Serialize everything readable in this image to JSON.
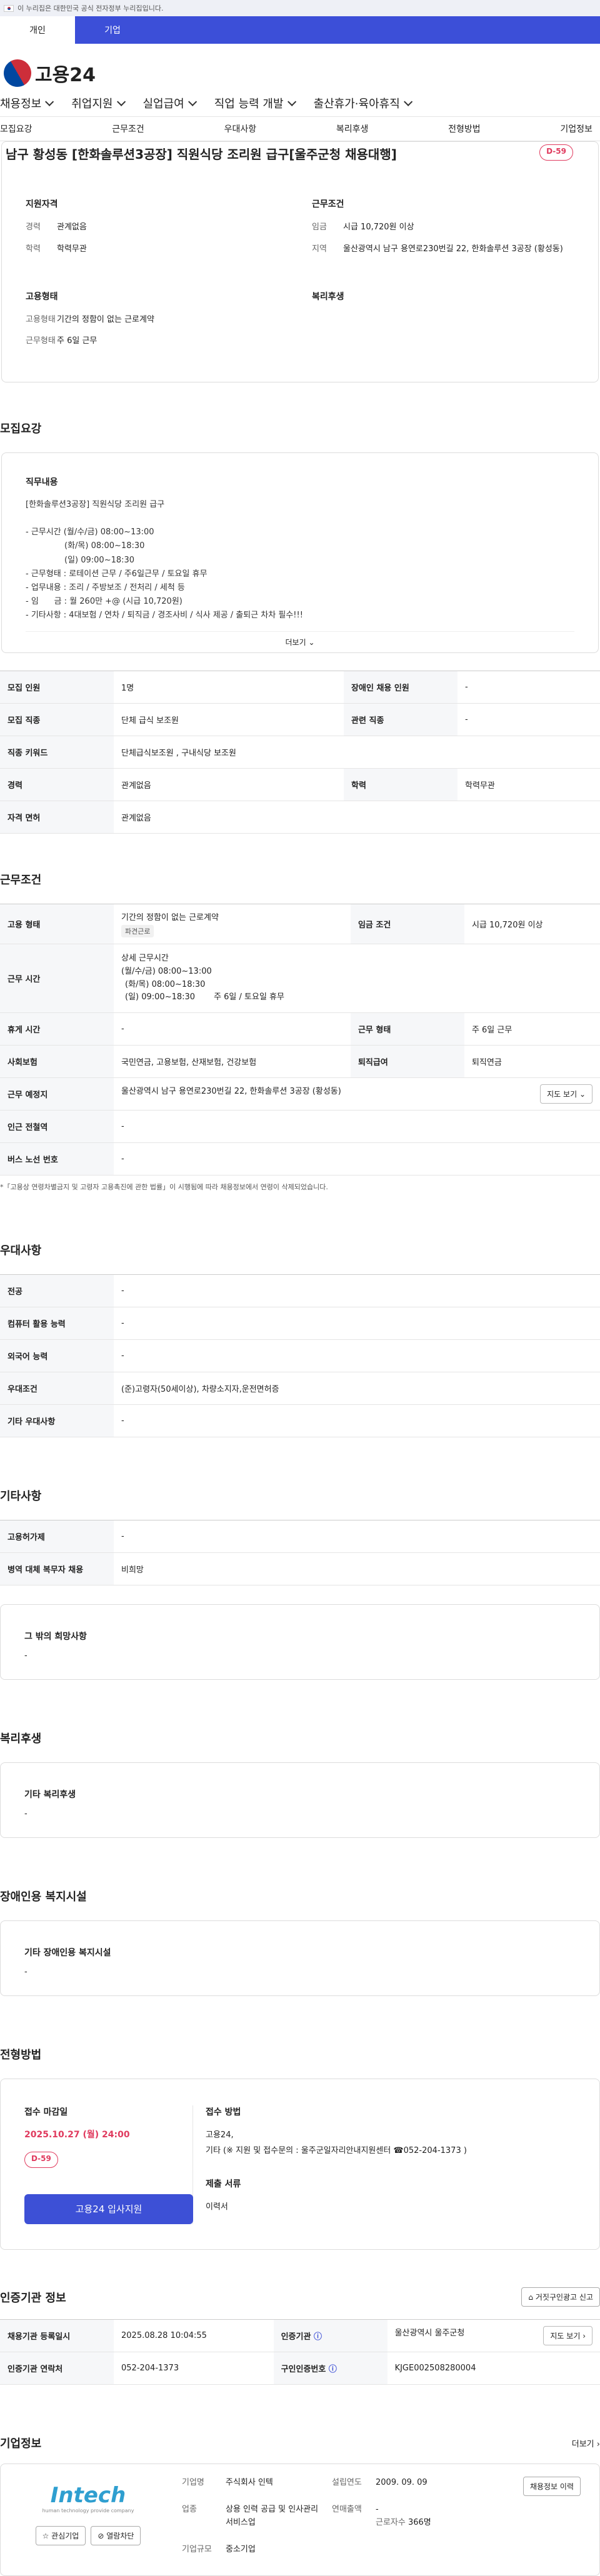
{
  "gov_notice": "이 누리집은 대한민국 공식 전자정부 누리집입니다.",
  "user_tabs": [
    "개인",
    "기업"
  ],
  "logo_text": "고용24",
  "gnb": [
    "채용정보",
    "취업지원",
    "실업급여",
    "직업 능력 개발",
    "출산휴가·육아휴직"
  ],
  "snb": [
    "모집요강",
    "근무조건",
    "우대사항",
    "복리후생",
    "전형방법",
    "기업정보"
  ],
  "title": "남구 황성동 [한화솔루션3공장] 직원식당 조리원 급구[울주군청 채용대행]",
  "dday": "D-59",
  "summary": {
    "req_title": "지원자격",
    "career_k": "경력",
    "career_v": "관계없음",
    "edu_k": "학력",
    "edu_v": "학력무관",
    "cond_title": "근무조건",
    "pay_k": "임금",
    "pay_v": "시급 10,720원 이상",
    "area_k": "지역",
    "area_v": "울산광역시 남구 용연로230번길 22, 한화솔루션 3공장 (황성동)",
    "emp_title": "고용형태",
    "emp_k": "고용형태",
    "emp_v": "기간의 정함이 없는 근로계약",
    "work_k": "근무형태",
    "work_v": "주 6일 근무",
    "welfare_title": "복리후생"
  },
  "recruit": {
    "title": "모집요강",
    "job_label": "직무내용",
    "job_text": "[한화솔루션3공장] 직원식당 조리원 급구\n\n- 근무시간 (월/수/금) 08:00~13:00\n               (화/목) 08:00~18:30\n               (일) 09:00~18:30\n- 근무형태 : 로테이션 근무 / 주6일근무 / 토요일 휴무\n- 업무내용 : 조리 / 주방보조 / 전처리 / 세척 등\n- 임      금 : 월 260만 +@ (시급 10,720원)\n- 기타사항 : 4대보험 / 연차 / 퇴직금 / 경조사비 / 식사 제공 / 출퇴근 차차 필수!!!",
    "more": "더보기",
    "rows": [
      [
        "모집 인원",
        "1명",
        "장애인 채용 인원",
        "-"
      ],
      [
        "모집 직종",
        "단체 급식 보조원",
        "관련 직종",
        "-"
      ],
      [
        "직종 키워드",
        "단체급식보조원 , 구내식당 보조원",
        "",
        ""
      ],
      [
        "경력",
        "관계없음",
        "학력",
        "학력무관"
      ],
      [
        "자격 면허",
        "관계없음",
        "",
        ""
      ]
    ]
  },
  "work": {
    "title": "근무조건",
    "emp_k": "고용 형태",
    "emp_v": "기간의 정함이 없는 근로계약",
    "emp_tag": "파견근로",
    "pay_k": "임금 조건",
    "pay_v": "시급 10,720원 이상",
    "time_k": "근무 시간",
    "time_title": "상세 근무시간",
    "time_lines": [
      "(월/수/금) 08:00~13:00",
      "(화/목) 08:00~18:30",
      "(일) 09:00~18:30"
    ],
    "time_extra": "주 6일 / 토요일 휴무",
    "rest_k": "휴게 시간",
    "rest_v": "-",
    "form_k": "근무 형태",
    "form_v": "주 6일 근무",
    "ins_k": "사회보험",
    "ins_v": "국민연금, 고용보험, 산재보험, 건강보험",
    "ret_k": "퇴직급여",
    "ret_v": "퇴직연금",
    "place_k": "근무 예정지",
    "place_v": "울산광역시 남구 용연로230번길 22, 한화솔루션 3공장 (황성동)",
    "map_btn": "지도 보기",
    "sub_k": "인근 전철역",
    "sub_v": "-",
    "bus_k": "버스 노선 번호",
    "bus_v": "-",
    "note": "*「고용상 연령차별금지 및 고령자 고용촉진에 관한 법률」이 시행됨에 따라 채용정보에서 연령이 삭제되었습니다."
  },
  "prefer": {
    "title": "우대사항",
    "rows": [
      [
        "전공",
        "-"
      ],
      [
        "컴퓨터 활용 능력",
        "-"
      ],
      [
        "외국어 능력",
        "-"
      ],
      [
        "우대조건",
        "(준)고령자(50세이상), 차량소지자,운전면허증"
      ],
      [
        "기타 우대사항",
        "-"
      ]
    ]
  },
  "etc": {
    "title": "기타사항",
    "rows": [
      [
        "고용허가제",
        "-"
      ],
      [
        "병역 대체 복무자 채용",
        "비희망"
      ]
    ],
    "wish_label": "그 밖의 희망사항",
    "wish_v": "-"
  },
  "welfare": {
    "title": "복리후생",
    "label": "기타 복리후생",
    "v": "-"
  },
  "disabled": {
    "title": "장애인용 복지시설",
    "label": "기타 장애인용 복지시설",
    "v": "-"
  },
  "process": {
    "title": "전형방법",
    "deadline_label": "접수 마감일",
    "deadline": "2025.10.27 (월) 24:00",
    "dday": "D-59",
    "apply_btn": "고용24 입사지원",
    "method_label": "접수 방법",
    "method_v1": "고용24,",
    "method_v2": "기타 (※ 지원 및 접수문의 : 울주군일자리안내지원센터 ☎052-204-1373 )",
    "doc_label": "제출 서류",
    "doc_v": "이력서"
  },
  "cert": {
    "title": "인증기관 정보",
    "report_btn": "거짓구인광고 신고",
    "reg_k": "채용기관 등록일시",
    "reg_v": "2025.08.28 10:04:55",
    "org_k": "인증기관",
    "org_v": "울산광역시 울주군청",
    "map_btn": "지도 보기",
    "tel_k": "인증기관 연락처",
    "tel_v": "052-204-1373",
    "id_k": "구인인증번호",
    "id_v": "KJGE002508280004"
  },
  "company": {
    "title": "기업정보",
    "more": "더보기",
    "logo_text": "Intech",
    "logo_sub": "human technology provide company",
    "fav_btn": "관심기업",
    "block_btn": "열람차단",
    "type_k": "기업명",
    "type_v": "주식회사 인텍",
    "biz_k": "업종",
    "biz_v": "상용 인력 공급 및 인사관리 서비스업",
    "size_k": "기업규모",
    "size_v": "중소기업",
    "est_k": "설립연도",
    "est_v": "2009. 09. 09",
    "sales_k": "연매출액",
    "sales_v": "-",
    "emp_k": "근로자수",
    "emp_v": "366명",
    "jobs_btn": "채용정보 이력"
  }
}
